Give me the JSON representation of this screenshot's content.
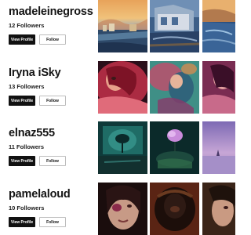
{
  "buttons": {
    "view_profile": "View Profile",
    "follow": "Follow"
  },
  "users": [
    {
      "username": "madeleinegross",
      "followers": "12 Followers"
    },
    {
      "username": "Iryna iSky",
      "followers": "13 Followers"
    },
    {
      "username": "elnaz555",
      "followers": "11 Followers"
    },
    {
      "username": "pamelaloud",
      "followers": "10 Followers"
    }
  ]
}
